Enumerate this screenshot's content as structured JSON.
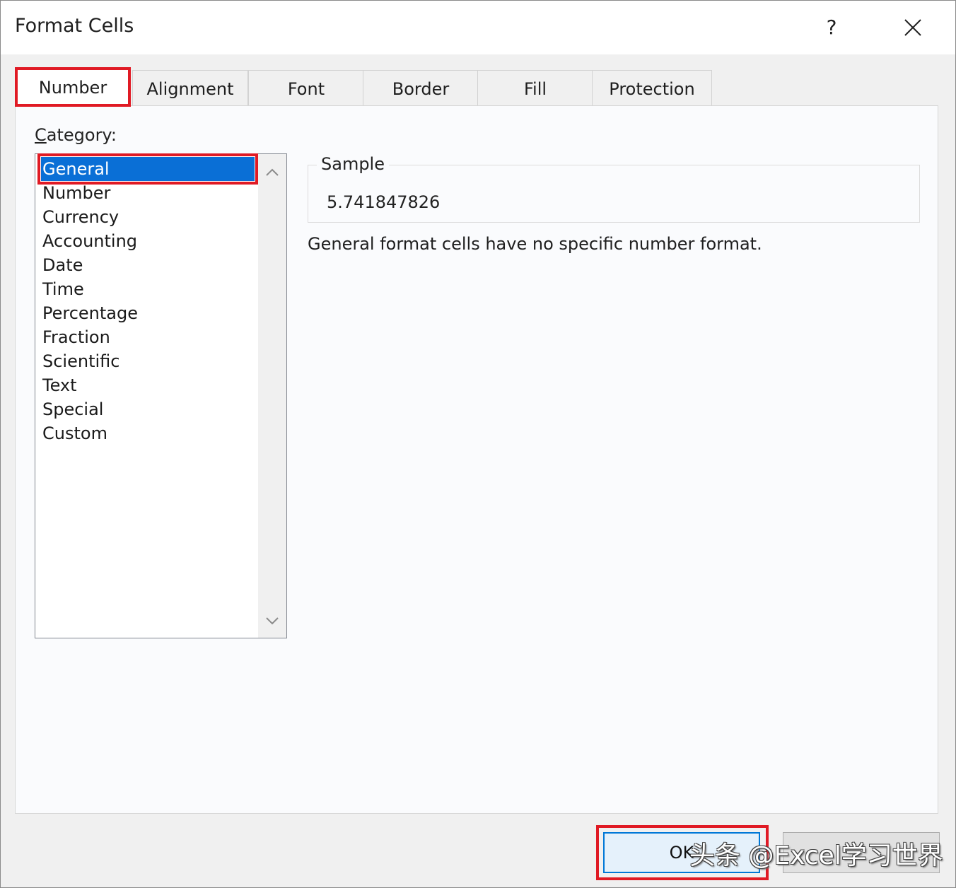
{
  "window": {
    "title": "Format Cells",
    "help_label": "?"
  },
  "tabs": [
    {
      "label": "Number",
      "active": true
    },
    {
      "label": "Alignment",
      "active": false
    },
    {
      "label": "Font",
      "active": false
    },
    {
      "label": "Border",
      "active": false
    },
    {
      "label": "Fill",
      "active": false
    },
    {
      "label": "Protection",
      "active": false
    }
  ],
  "category": {
    "label_first": "C",
    "label_rest": "ategory:",
    "items": [
      "General",
      "Number",
      "Currency",
      "Accounting",
      "Date",
      "Time",
      "Percentage",
      "Fraction",
      "Scientific",
      "Text",
      "Special",
      "Custom"
    ],
    "selected": "General"
  },
  "sample": {
    "legend": "Sample",
    "value": "5.741847826"
  },
  "description": "General format cells have no specific number format.",
  "buttons": {
    "ok_label": "OK",
    "cancel_label": ""
  },
  "watermark": "头条 @Excel学习世界",
  "colors": {
    "highlight": "#e01a24",
    "selection": "#0a6fd6"
  }
}
